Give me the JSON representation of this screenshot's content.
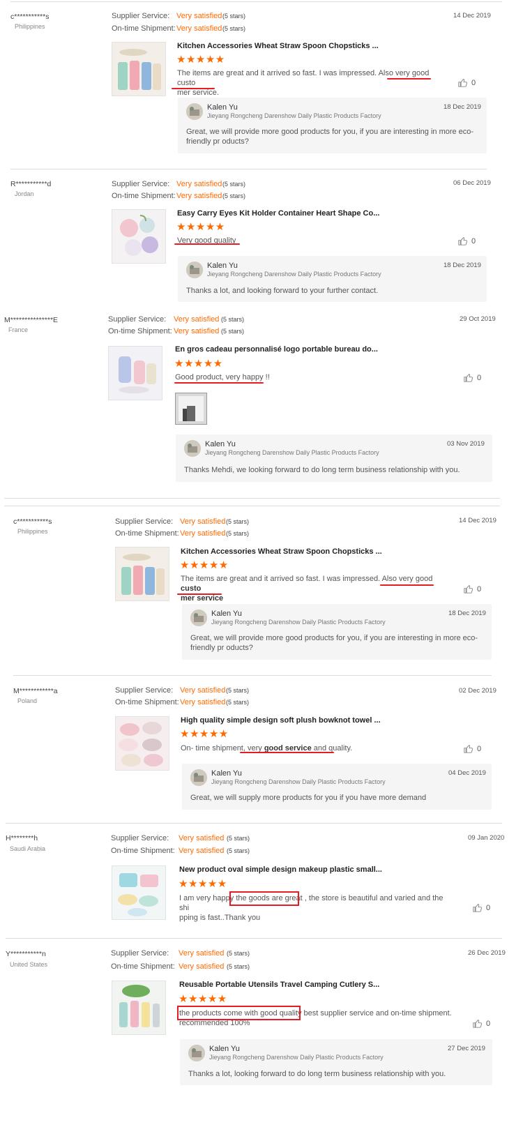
{
  "labels": {
    "supplier_service": "Supplier Service:",
    "ontime_shipment": "On-time Shipment:"
  },
  "colors": {
    "accent": "#ff6a00",
    "highlight": "#e51c23",
    "reply_bg": "#f5f5f5"
  },
  "reviews": [
    {
      "buyer": "c***********s",
      "country": "Philippines",
      "date": "14 Dec 2019",
      "supplier_service": "Very satisfied",
      "supplier_stars": "(5 stars)",
      "ontime": "Very satisfied",
      "ontime_stars": "(5 stars)",
      "product": "Kitchen Accessories Wheat Straw Spoon Chopsticks ...",
      "stars": "★★★★★",
      "text_a": "The items are great and it arrived so fast. I was impressed.  Also very ",
      "text_b": "good custo",
      "text_c": "mer service",
      "text_d": ".",
      "likes": "0",
      "reply": {
        "name": "Kalen Yu",
        "company": "Jieyang Rongcheng Darenshow Daily Plastic Products Factory",
        "date": "18 Dec 2019",
        "text": "Great, we will provide more good products for you, if you are interesting in more eco-friendly pr oducts?"
      }
    },
    {
      "buyer": "R***********d",
      "country": "Jordan",
      "date": "06 Dec 2019",
      "supplier_service": "Very satisfied",
      "supplier_stars": "(5 stars)",
      "ontime": "Very satisfied",
      "ontime_stars": "(5 stars)",
      "product": "Easy Carry Eyes Kit Holder Container Heart Shape Co...",
      "stars": "★★★★★",
      "text": "Very good quality",
      "likes": "0",
      "reply": {
        "name": "Kalen Yu",
        "company": "Jieyang Rongcheng Darenshow Daily Plastic Products Factory",
        "date": "18 Dec 2019",
        "text": "Thanks a lot, and looking forward to your further contact."
      }
    },
    {
      "buyer": "M***************E",
      "country": "France",
      "date": "29 Oct 2019",
      "supplier_service": "Very satisfied",
      "supplier_stars": "(5 stars)",
      "ontime": "Very satisfied",
      "ontime_stars": "(5 stars)",
      "product": "En gros cadeau personnalisé logo portable bureau do...",
      "stars": "★★★★★",
      "text": "Good product, very happy !!",
      "likes": "0",
      "reply": {
        "name": "Kalen Yu",
        "company": "Jieyang Rongcheng Darenshow Daily Plastic Products Factory",
        "date": "03 Nov 2019",
        "text": "Thanks Mehdi, we looking forward to do long term business relationship with you."
      }
    },
    {
      "buyer": "c***********s",
      "country": "Philippines",
      "date": "14 Dec 2019",
      "supplier_service": "Very satisfied",
      "supplier_stars": "(5 stars)",
      "ontime": "Very satisfied",
      "ontime_stars": "(5 stars)",
      "product": "Kitchen Accessories Wheat Straw Spoon Chopsticks ...",
      "stars": "★★★★★",
      "text_a": "The items are great and it arrived so fast. I was impressed.  Also very good ",
      "text_b": "custo",
      "text_c": "mer service",
      "likes": "0",
      "reply": {
        "name": "Kalen Yu",
        "company": "Jieyang Rongcheng Darenshow Daily Plastic Products Factory",
        "date": "18 Dec 2019",
        "text": "Great, we will provide more good products for you, if you are interesting in more eco-friendly pr oducts?"
      }
    },
    {
      "buyer": "M************a",
      "country": "Poland",
      "date": "02 Dec 2019",
      "supplier_service": "Very satisfied",
      "supplier_stars": "(5 stars)",
      "ontime": "Very satisfied",
      "ontime_stars": "(5 stars)",
      "product": "High quality simple design soft plush bowknot towel ...",
      "stars": "★★★★★",
      "text_a": "On- time shipment, very ",
      "text_b": "good service",
      "text_c": " and quality.",
      "likes": "0",
      "reply": {
        "name": "Kalen Yu",
        "company": "Jieyang Rongcheng Darenshow Daily Plastic Products Factory",
        "date": "04 Dec 2019",
        "text": "Great, we will supply more products for you if you have more demand"
      }
    },
    {
      "buyer": "H********h",
      "country": "Saudi Arabia",
      "date": "09 Jan 2020",
      "supplier_service": "Very satisfied",
      "supplier_stars": "(5 stars)",
      "ontime": "Very satisfied",
      "ontime_stars": "(5 stars)",
      "product": "New product oval simple design makeup plastic small...",
      "stars": "★★★★★",
      "text_line1": "I am very happy the goods are great , the store is beautiful and varied and the shi",
      "text_line2": "pping is fast..Thank you",
      "likes": "0"
    },
    {
      "buyer": "Y***********n",
      "country": "United States",
      "date": "26 Dec 2019",
      "supplier_service": "Very satisfied",
      "supplier_stars": "(5 stars)",
      "ontime": "Very satisfied",
      "ontime_stars": "(5 stars)",
      "product": "Reusable Portable Utensils Travel Camping Cutlery S...",
      "stars": "★★★★★",
      "text_line1": "the products come with good quality best supplier service and on-time shipment.",
      "text_line2": "recommended 100%",
      "likes": "0",
      "reply": {
        "name": "Kalen Yu",
        "company": "Jieyang Rongcheng Darenshow Daily Plastic Products Factory",
        "date": "27 Dec 2019",
        "text": "Thanks a lot, looking forward to do long term business relationship with you."
      }
    }
  ]
}
